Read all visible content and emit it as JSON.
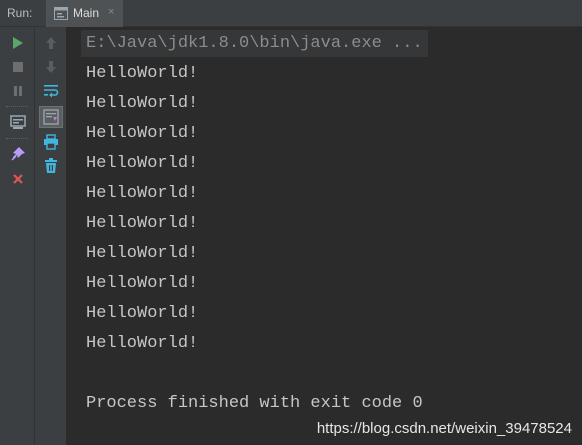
{
  "header": {
    "run_label": "Run:",
    "tab": {
      "label": "Main",
      "close": "×",
      "icon": "console-icon"
    }
  },
  "toolbar_left": [
    {
      "name": "rerun-icon",
      "color": "#59a869"
    },
    {
      "name": "stop-icon",
      "color": "#6e6e6e"
    },
    {
      "name": "pause-icon",
      "color": "#6e6e6e"
    },
    {
      "name": "dump-threads-icon",
      "color": "#9aa7b0"
    },
    {
      "name": "pin-icon",
      "color": "#b99bf8"
    },
    {
      "name": "close-icon",
      "color": "#e05555"
    }
  ],
  "toolbar_right": [
    {
      "name": "up-arrow-icon",
      "color": "#5a5d5f"
    },
    {
      "name": "down-arrow-icon",
      "color": "#5a5d5f"
    },
    {
      "name": "soft-wrap-icon",
      "color": "#40b6e0"
    },
    {
      "name": "scroll-to-end-icon",
      "color": "#9aa7b0"
    },
    {
      "name": "print-icon",
      "color": "#40b6e0"
    },
    {
      "name": "trash-icon",
      "color": "#40b6e0"
    }
  ],
  "console": {
    "command": "E:\\Java\\jdk1.8.0\\bin\\java.exe ...",
    "output_lines": [
      "HelloWorld!",
      "HelloWorld!",
      "HelloWorld!",
      "HelloWorld!",
      "HelloWorld!",
      "HelloWorld!",
      "HelloWorld!",
      "HelloWorld!",
      "HelloWorld!",
      "HelloWorld!"
    ],
    "exit_message": "Process finished with exit code 0"
  },
  "watermark": "https://blog.csdn.net/weixin_39478524"
}
